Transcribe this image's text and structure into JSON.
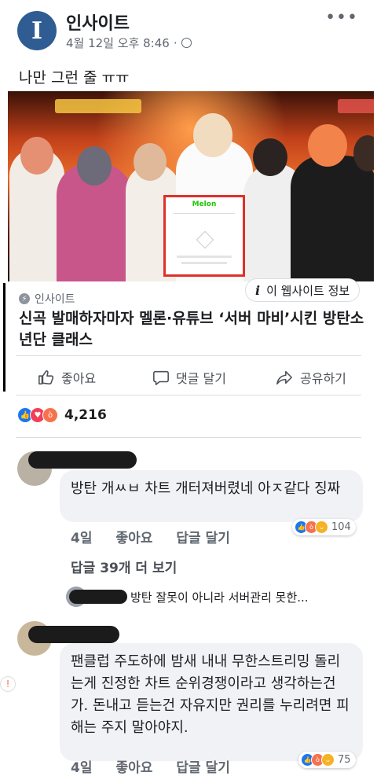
{
  "post": {
    "page_name": "인사이트",
    "avatar_letter": "I",
    "date": "4월 12일 오후 8:46",
    "dot": "·",
    "more": "•••",
    "text": "나만 그런 줄 ㅠㅠ"
  },
  "link_preview": {
    "phone_app": "Melon",
    "site_info_icon": "i",
    "site_info_label": "이 웹사이트 정보",
    "source": "인사이트",
    "headline": "신곡 발매하자마자 멜론·유튜브 ‘서버 마비’시킨 방탄소년단 클래스"
  },
  "actions": {
    "like": "좋아요",
    "comment": "댓글 달기",
    "share": "공유하기"
  },
  "reactions": {
    "count": "4,216",
    "types": [
      "like-icon",
      "love-icon",
      "angry-icon"
    ]
  },
  "comments": [
    {
      "text": "방탄 개ㅆㅂ 차트 개터져버렸네 아ㅈ같다 징짜",
      "time": "4일",
      "like": "좋아요",
      "reply": "답글 달기",
      "reaction_count": "104"
    },
    {
      "text": "팬클럽 주도하에 밤새 내내 무한스트리밍 돌리는게 진정한 차트 순위경쟁이라고 생각하는건가. 돈내고 듣는건 자유지만 권리를 누리려면 피해는 주지 말아야지.",
      "time": "4일",
      "like": "좋아요",
      "reply": "답글 달기",
      "reaction_count": "75"
    }
  ],
  "more_replies": "답글 39개 더 보기",
  "reply_preview": "방탄 잘못이 아니라 서버관리 못한..."
}
